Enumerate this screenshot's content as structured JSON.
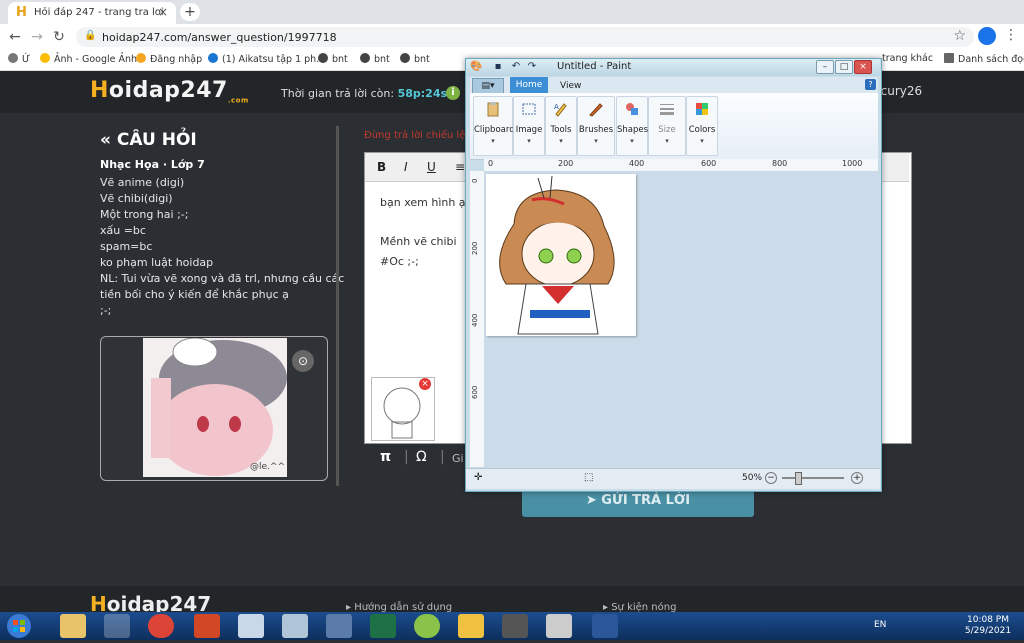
{
  "browser": {
    "tab_title": "Hỏi đáp 247 - trang tra loi",
    "url": "hoidap247.com/answer_question/1997718",
    "bookmarks": [
      "Ứ",
      "Ảnh - Google Ảnh",
      "Đăng nhập",
      "(1) Aikatsu tập 1 ph...",
      "bnt",
      "bnt",
      "bnt",
      "trang khác",
      "Danh sách đọc"
    ]
  },
  "site": {
    "logo_main": "oidap247",
    "logo_first": "H",
    "logo_sub": ".com",
    "timer_label": "Thời gian trả lời còn:",
    "timer_value": "58p:24s",
    "info_icon": "i",
    "username": "rcury26"
  },
  "question": {
    "heading": "« CÂU HỎI",
    "subject": "Nhạc Họa · Lớp 7",
    "lines": [
      "Vẽ anime (digi)",
      "Vẽ chibi(digi)",
      "Một trong hai ;-;",
      "xấu =bc",
      "spam=bc",
      "ko phạm luật hoidap",
      "NL: Tui vừa vẽ xong và đã trl, nhưng cầu các",
      "tiền bối cho ý kiến để khắc phục ạ",
      ";-;"
    ],
    "image_caption": "@le.^^"
  },
  "answer": {
    "hint": "Đừng trả lời chiếu lệ...",
    "text_line1": "bạn xem hình ạ",
    "text_line2": "Mềnh vẽ chibi",
    "text_line3": "#Oc ;-;",
    "toolbar": {
      "bold": "B",
      "italic": "I",
      "underline": "U"
    },
    "math_pi": "π",
    "math_omega": "Ω",
    "math_more": "Gi",
    "submit_label": "GỬI TRẢ LỜI"
  },
  "footer": {
    "logo_first": "H",
    "logo": "oidap247",
    "link1": "Hướng dẫn sử dụng",
    "link2": "Sự kiện nóng"
  },
  "paint": {
    "title": "Untitled - Paint",
    "tab_home": "Home",
    "tab_view": "View",
    "groups": [
      "Clipboard",
      "Image",
      "Tools",
      "Brushes",
      "Shapes",
      "Size",
      "Colors"
    ],
    "ruler_h": [
      "0",
      "200",
      "400",
      "600",
      "800",
      "1000"
    ],
    "ruler_v": [
      "0",
      "200",
      "400",
      "600"
    ],
    "zoom": "50%",
    "zoom_level": 0.25
  },
  "taskbar": {
    "lang": "EN",
    "time": "10:08 PM",
    "date": "5/29/2021"
  }
}
